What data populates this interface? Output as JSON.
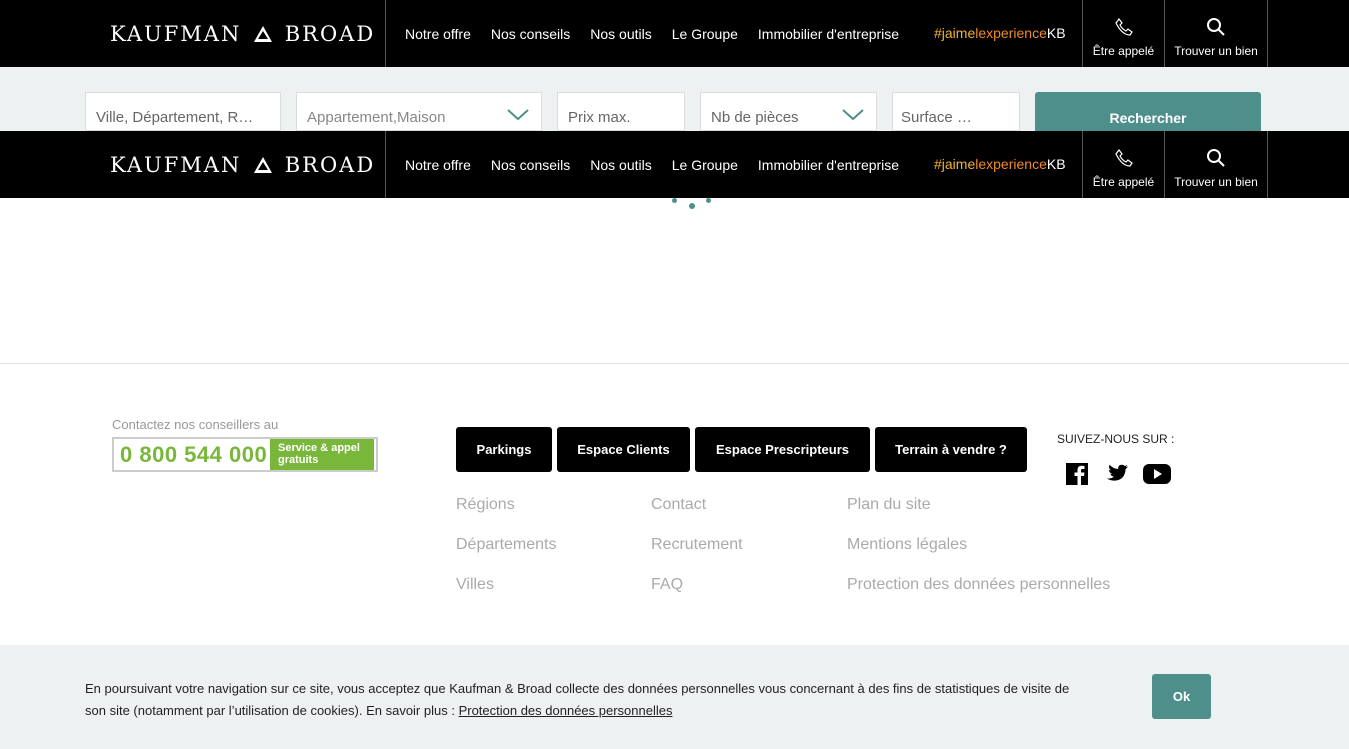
{
  "header": {
    "logo_left": "KAUFMAN",
    "logo_right": "BROAD",
    "nav": [
      "Notre offre",
      "Nos conseils",
      "Nos outils",
      "Le Groupe",
      "Immobilier d'entreprise"
    ],
    "hashtag": {
      "part1": "#jaime",
      "part2": "lexperience",
      "part3": "KB"
    },
    "call_label": "Être appelé",
    "find_label": "Trouver un bien"
  },
  "search": {
    "location_placeholder": "Ville, Département, R…",
    "type_placeholder": "Appartement,Maison",
    "price_placeholder": "Prix max.",
    "rooms_placeholder": "Nb de pièces",
    "surface_placeholder": "Surface …",
    "button": "Rechercher"
  },
  "footer": {
    "contact_label": "Contactez nos conseillers au",
    "phone": "0 800 544 000",
    "phone_tag_line1": "Service & appel",
    "phone_tag_line2": "gratuits",
    "buttons": [
      "Parkings",
      "Espace Clients",
      "Espace Prescripteurs",
      "Terrain à vendre ?"
    ],
    "follow": "SUIVEZ-NOUS SUR :",
    "links": {
      "col1": [
        "Régions",
        "Départements",
        "Villes"
      ],
      "col2": [
        "Contact",
        "Recrutement",
        "FAQ"
      ],
      "col3": [
        "Plan du site",
        "Mentions légales",
        "Protection des données personnelles"
      ]
    }
  },
  "cookie": {
    "text": "En poursuivant votre navigation sur ce site, vous acceptez que Kaufman & Broad collecte des données personnelles vous concernant à des fins de statistiques de visite de son site (notamment par l’utilisation de cookies). En savoir plus : ",
    "link": "Protection des données personnelles",
    "ok": "Ok"
  },
  "colors": {
    "accent": "#4e8f8c",
    "phone_green": "#78b73a",
    "hashtag_yellow": "#f2b233",
    "hashtag_orange": "#f08a24"
  }
}
